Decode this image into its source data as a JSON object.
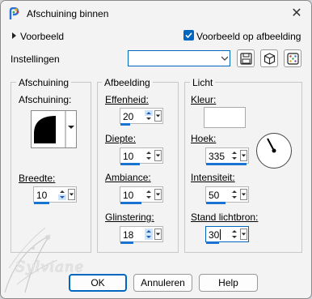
{
  "window": {
    "title": "Afschuining binnen",
    "close_icon": "close-icon"
  },
  "preview_row": {
    "toggle_label": "Voorbeeld",
    "checkbox_label": "Voorbeeld op afbeelding",
    "checkbox_checked": true
  },
  "settings": {
    "label": "Instellingen",
    "combo_value": ""
  },
  "groups": {
    "bevel": {
      "title": "Afschuining",
      "shape_label": "Afschuining:",
      "width_label": "Breedte:",
      "width_value": "10"
    },
    "image": {
      "title": "Afbeelding",
      "smoothness_label": "Effenheid:",
      "smoothness_value": "20",
      "depth_label": "Diepte:",
      "depth_value": "10",
      "ambience_label": "Ambiance:",
      "ambience_value": "10",
      "shininess_label": "Glinstering:",
      "shininess_value": "18"
    },
    "light": {
      "title": "Licht",
      "color_label": "Kleur:",
      "color_value": "#ffffff",
      "angle_label": "Hoek:",
      "angle_value": "335",
      "intensity_label": "Intensiteit:",
      "intensity_value": "50",
      "elevation_label": "Stand lichtbron:",
      "elevation_value": "30"
    }
  },
  "buttons": {
    "ok": "OK",
    "cancel": "Annuleren",
    "help": "Help"
  },
  "watermark": {
    "signature": "Sylviane"
  },
  "colors": {
    "accent": "#0067c0",
    "slider": "#1a73d1"
  }
}
